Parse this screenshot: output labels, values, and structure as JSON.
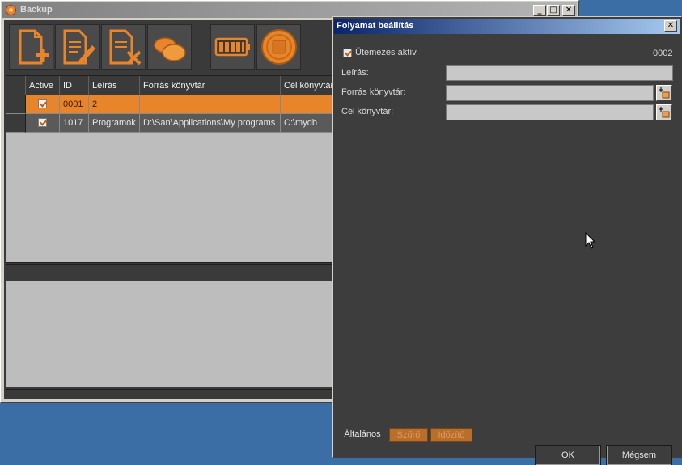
{
  "backup_window": {
    "title": "Backup",
    "caption_buttons": [
      "_",
      "□",
      "✕"
    ],
    "toolbar": [
      {
        "icon": "new-document-icon"
      },
      {
        "icon": "edit-document-icon"
      },
      {
        "icon": "delete-document-icon"
      },
      {
        "icon": "coins-icon"
      },
      {
        "icon": "battery-icon"
      },
      {
        "icon": "stop-icon"
      }
    ],
    "grid": {
      "columns": [
        "Active",
        "ID",
        "Leírás",
        "Forrás könyvtár",
        "Cél könyvtár"
      ],
      "rows": [
        {
          "active": true,
          "id": "0001",
          "description": "2",
          "source": "",
          "target": "",
          "selected": true
        },
        {
          "active": true,
          "id": "1017",
          "description": "Programok",
          "source": "D:\\San\\Applications\\My programs",
          "target": "C:\\mydb",
          "selected": false
        }
      ]
    }
  },
  "dialog": {
    "title": "Folyamat beállítás",
    "close": "✕",
    "schedule_active_label": "Ütemezés aktív",
    "schedule_active_checked": true,
    "id_value": "0002",
    "description_label": "Leírás:",
    "description_value": "",
    "source_label": "Forrás könyvtár:",
    "source_value": "",
    "target_label": "Cél könyvtár:",
    "target_value": "",
    "tabs": [
      "Általános",
      "Szűrő",
      "Időzítő"
    ],
    "ok_label": "OK",
    "cancel_label": "Mégsem"
  },
  "colors": {
    "accent": "#e8852a",
    "desktop": "#3a6ea5",
    "dark_panel": "#3d3d3d",
    "title_active": "#0a246a"
  }
}
